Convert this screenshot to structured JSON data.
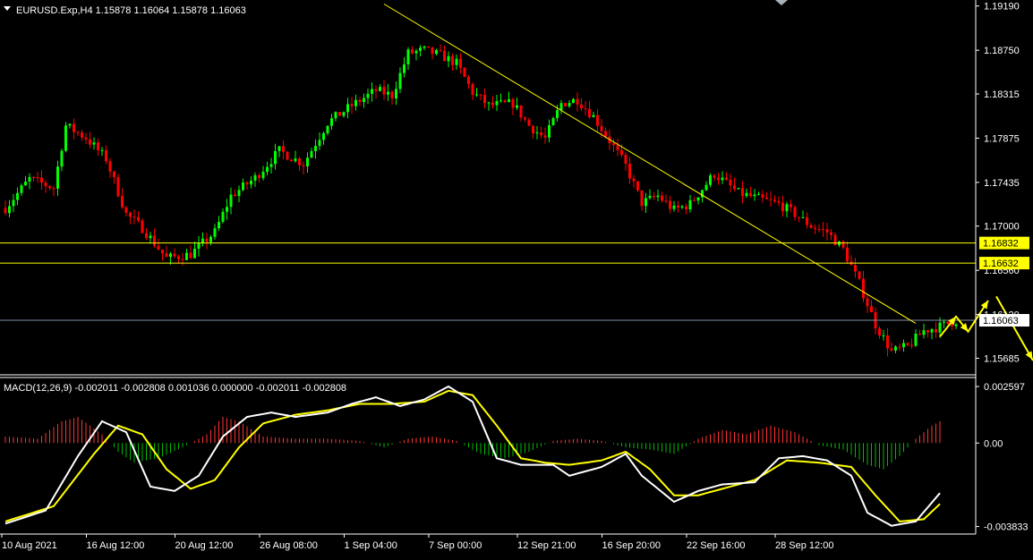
{
  "header": {
    "symbol_line": "EURUSD.Exp,H4  1.15878 1.16064 1.15878 1.16063",
    "macd_line": "MACD(12,26,9) -0.002011 -0.002808 0.001036 0.000000 -0.002011 -0.002808"
  },
  "colors": {
    "background": "#000000",
    "bull_candle": "#00ff00",
    "bear_candle": "#ff0000",
    "trendline": "#ffff00",
    "level_line": "#ffff00",
    "current_price_line": "#8090a8",
    "macd_main": "#ffffff",
    "macd_signal": "#ffff00",
    "hist_up": "#ff3333",
    "hist_down": "#00bb00",
    "arrow": "#ffff00"
  },
  "chart_data": [
    {
      "type": "candlestick",
      "symbol": "EURUSD.Exp",
      "timeframe": "H4",
      "ylim": [
        1.1552,
        1.1925
      ],
      "y_ticks": [
        "1.19190",
        "1.18750",
        "1.18315",
        "1.17875",
        "1.17435",
        "1.17000",
        "1.16560",
        "1.16120",
        "1.15685"
      ],
      "x_ticks": [
        "10 Aug 2021",
        "16 Aug 12:00",
        "20 Aug 12:00",
        "26 Aug 08:00",
        "1 Sep 04:00",
        "7 Sep 00:00",
        "12 Sep 21:00",
        "16 Sep 20:00",
        "22 Sep 16:00",
        "28 Sep 12:00"
      ],
      "horizontal_levels": [
        {
          "price": 1.16832,
          "label": "1.16832"
        },
        {
          "price": 1.16632,
          "label": "1.16632"
        }
      ],
      "current_price": {
        "price": 1.16063,
        "label": "1.16063"
      },
      "trendline": {
        "start": {
          "bar": 94,
          "price": 1.1921
        },
        "end": {
          "bar": 226,
          "price": 1.16032
        }
      },
      "ohlc_keypoints": [
        [
          0,
          1.1718
        ],
        [
          6,
          1.1747
        ],
        [
          12,
          1.1738
        ],
        [
          15,
          1.18
        ],
        [
          20,
          1.1788
        ],
        [
          25,
          1.1767
        ],
        [
          30,
          1.1712
        ],
        [
          34,
          1.1698
        ],
        [
          40,
          1.1668
        ],
        [
          46,
          1.1672
        ],
        [
          52,
          1.1694
        ],
        [
          56,
          1.173
        ],
        [
          62,
          1.1748
        ],
        [
          68,
          1.1775
        ],
        [
          74,
          1.1762
        ],
        [
          80,
          1.1803
        ],
        [
          86,
          1.182
        ],
        [
          92,
          1.1835
        ],
        [
          96,
          1.183
        ],
        [
          100,
          1.1872
        ],
        [
          104,
          1.1875
        ],
        [
          108,
          1.187
        ],
        [
          112,
          1.1862
        ],
        [
          116,
          1.1833
        ],
        [
          120,
          1.182
        ],
        [
          126,
          1.1822
        ],
        [
          130,
          1.18
        ],
        [
          134,
          1.1787
        ],
        [
          138,
          1.1822
        ],
        [
          142,
          1.1826
        ],
        [
          146,
          1.1809
        ],
        [
          150,
          1.1785
        ],
        [
          154,
          1.176
        ],
        [
          158,
          1.1723
        ],
        [
          162,
          1.173
        ],
        [
          166,
          1.1716
        ],
        [
          170,
          1.1722
        ],
        [
          176,
          1.1752
        ],
        [
          182,
          1.1733
        ],
        [
          188,
          1.1726
        ],
        [
          192,
          1.1722
        ],
        [
          196,
          1.1712
        ],
        [
          200,
          1.17
        ],
        [
          204,
          1.1694
        ],
        [
          208,
          1.1677
        ],
        [
          212,
          1.1643
        ],
        [
          216,
          1.1602
        ],
        [
          220,
          1.1575
        ],
        [
          224,
          1.158
        ],
        [
          228,
          1.1596
        ],
        [
          232,
          1.16
        ],
        [
          236,
          1.1606
        ]
      ],
      "annotation_arrows": [
        [
          [
            232,
            1.159
          ],
          [
            236,
            1.161
          ],
          [
            239,
            1.1595
          ],
          [
            244,
            1.1626
          ]
        ],
        [
          [
            246,
            1.163
          ],
          [
            255,
            1.1567
          ],
          [
            266,
            1.1578
          ]
        ],
        [
          [
            268,
            1.1587
          ],
          [
            270,
            1.1535
          ]
        ]
      ]
    },
    {
      "type": "macd",
      "title": "MACD(12,26,9)",
      "params": [
        12,
        26,
        9
      ],
      "ylim": [
        -0.00418,
        0.00301
      ],
      "y_ticks": [
        "0.002597",
        "0.00",
        "-0.003833"
      ],
      "main_keypoints": [
        [
          0,
          -0.0037
        ],
        [
          10,
          -0.0031
        ],
        [
          18,
          -0.0006
        ],
        [
          24,
          0.001
        ],
        [
          30,
          0.0005
        ],
        [
          36,
          -0.002
        ],
        [
          42,
          -0.0022
        ],
        [
          48,
          -0.0015
        ],
        [
          54,
          0.0003
        ],
        [
          60,
          0.0012
        ],
        [
          66,
          0.0014
        ],
        [
          72,
          0.0012
        ],
        [
          80,
          0.0014
        ],
        [
          86,
          0.0018
        ],
        [
          92,
          0.0021
        ],
        [
          98,
          0.0017
        ],
        [
          104,
          0.002
        ],
        [
          110,
          0.0026
        ],
        [
          116,
          0.0019
        ],
        [
          122,
          -0.0007
        ],
        [
          128,
          -0.001
        ],
        [
          136,
          -0.001
        ],
        [
          140,
          -0.0015
        ],
        [
          148,
          -0.0011
        ],
        [
          154,
          -0.0005
        ],
        [
          158,
          -0.0015
        ],
        [
          166,
          -0.0027
        ],
        [
          172,
          -0.0022
        ],
        [
          178,
          -0.0019
        ],
        [
          186,
          -0.0018
        ],
        [
          192,
          -0.0007
        ],
        [
          198,
          -0.0006
        ],
        [
          204,
          -0.0008
        ],
        [
          210,
          -0.0015
        ],
        [
          214,
          -0.0032
        ],
        [
          220,
          -0.0038
        ],
        [
          226,
          -0.0036
        ],
        [
          232,
          -0.0023
        ]
      ],
      "signal_keypoints": [
        [
          0,
          -0.0036
        ],
        [
          12,
          -0.0029
        ],
        [
          22,
          -0.0005
        ],
        [
          28,
          0.0008
        ],
        [
          34,
          0.0004
        ],
        [
          40,
          -0.0012
        ],
        [
          46,
          -0.0021
        ],
        [
          52,
          -0.0017
        ],
        [
          58,
          -0.0002
        ],
        [
          64,
          0.0009
        ],
        [
          72,
          0.0013
        ],
        [
          80,
          0.0015
        ],
        [
          88,
          0.0018
        ],
        [
          96,
          0.0018
        ],
        [
          104,
          0.0019
        ],
        [
          110,
          0.0024
        ],
        [
          116,
          0.0022
        ],
        [
          122,
          0.0008
        ],
        [
          128,
          -0.0007
        ],
        [
          134,
          -0.0009
        ],
        [
          140,
          -0.001
        ],
        [
          148,
          -0.0008
        ],
        [
          154,
          -0.0004
        ],
        [
          160,
          -0.0012
        ],
        [
          166,
          -0.0024
        ],
        [
          172,
          -0.0024
        ],
        [
          178,
          -0.0021
        ],
        [
          186,
          -0.0017
        ],
        [
          194,
          -0.0008
        ],
        [
          202,
          -0.0009
        ],
        [
          210,
          -0.0011
        ],
        [
          216,
          -0.0024
        ],
        [
          222,
          -0.0036
        ],
        [
          228,
          -0.0035
        ],
        [
          232,
          -0.0028
        ]
      ],
      "histogram_keypoints": [
        [
          0,
          0.0003
        ],
        [
          8,
          0.0002
        ],
        [
          14,
          0.001
        ],
        [
          18,
          0.0012
        ],
        [
          24,
          0.0004
        ],
        [
          28,
          -0.0004
        ],
        [
          32,
          -0.0009
        ],
        [
          38,
          -0.0007
        ],
        [
          44,
          -0.0002
        ],
        [
          50,
          0.0004
        ],
        [
          54,
          0.0012
        ],
        [
          58,
          0.001
        ],
        [
          64,
          0.0003
        ],
        [
          72,
          0.0002
        ],
        [
          80,
          0.0002
        ],
        [
          88,
          0.0001
        ],
        [
          94,
          -0.0002
        ],
        [
          100,
          0.0002
        ],
        [
          106,
          0.0003
        ],
        [
          112,
          0.0001
        ],
        [
          118,
          -0.0005
        ],
        [
          124,
          -0.0007
        ],
        [
          130,
          -0.0004
        ],
        [
          136,
          0.0001
        ],
        [
          142,
          0.0002
        ],
        [
          148,
          0.0001
        ],
        [
          154,
          -0.0002
        ],
        [
          160,
          -0.0003
        ],
        [
          166,
          -0.0005
        ],
        [
          172,
          0.0002
        ],
        [
          178,
          0.0006
        ],
        [
          184,
          0.0004
        ],
        [
          190,
          0.0008
        ],
        [
          196,
          0.0005
        ],
        [
          202,
          -0.0001
        ],
        [
          208,
          -0.0003
        ],
        [
          214,
          -0.001
        ],
        [
          218,
          -0.0012
        ],
        [
          222,
          -0.0006
        ],
        [
          226,
          0.0002
        ],
        [
          230,
          0.0008
        ],
        [
          232,
          0.001
        ]
      ]
    }
  ]
}
